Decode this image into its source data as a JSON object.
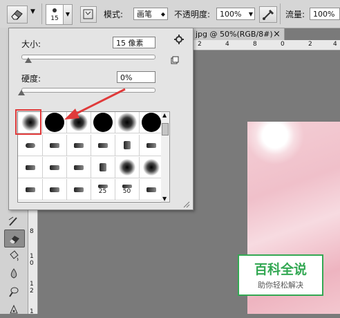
{
  "options_bar": {
    "brush_size": "15",
    "mode_label": "模式:",
    "mode_value": "画笔",
    "opacity_label": "不透明度:",
    "opacity_value": "100%",
    "flow_label": "流量:",
    "flow_value": "100%"
  },
  "document": {
    "tab_title": "jpg @ 50%(RGB/8#)",
    "close_glyph": "×",
    "ruler_h_labels": [
      "2",
      "4",
      "6",
      "8",
      "0",
      "2",
      "4",
      "6"
    ],
    "ruler_v_labels": [
      "8",
      "1",
      "0",
      "1",
      "2",
      "1"
    ]
  },
  "brush_panel": {
    "size_label": "大小:",
    "size_value": "15 像素",
    "size_level": 0.05,
    "hardness_label": "硬度:",
    "hardness_value": "0%",
    "hardness_level": 0.0,
    "preset_numbers": [
      "25",
      "50"
    ],
    "highlight_color": "#e03a3a"
  },
  "watermark": {
    "title": "百科全说",
    "subtitle": "助你轻松解决",
    "color": "#33a853"
  },
  "icons": [
    "eraser-icon",
    "brush-preview-icon",
    "brush-panel-toggle-icon",
    "airbrush-icon",
    "gear-icon",
    "new-preset-icon",
    "scroll-up-icon",
    "scroll-down-icon"
  ]
}
